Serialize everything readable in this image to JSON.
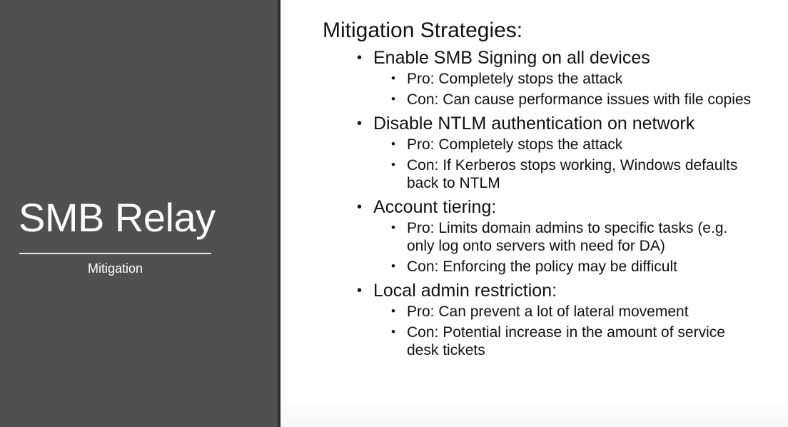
{
  "slide": {
    "title": "SMB Relay",
    "subtitle": "Mitigation",
    "heading": "Mitigation Strategies:",
    "colors": {
      "left_panel": "#505050",
      "text_dark": "#111111",
      "text_light": "#ffffff"
    },
    "bullet_glyph": "•",
    "sections": [
      {
        "label": "Enable SMB Signing on all devices",
        "points": [
          "Pro: Completely stops the attack",
          "Con: Can cause performance issues with file copies"
        ]
      },
      {
        "label": "Disable NTLM authentication on network",
        "points": [
          "Pro: Completely stops the attack",
          "Con: If Kerberos stops working, Windows defaults back to NTLM"
        ]
      },
      {
        "label": "Account tiering:",
        "points": [
          "Pro: Limits domain admins to specific tasks (e.g. only log onto servers with need for DA)",
          "Con: Enforcing the policy may be difficult"
        ]
      },
      {
        "label": "Local admin restriction:",
        "points": [
          "Pro: Can prevent a lot of lateral movement",
          "Con: Potential increase in the amount of service desk tickets"
        ]
      }
    ]
  }
}
